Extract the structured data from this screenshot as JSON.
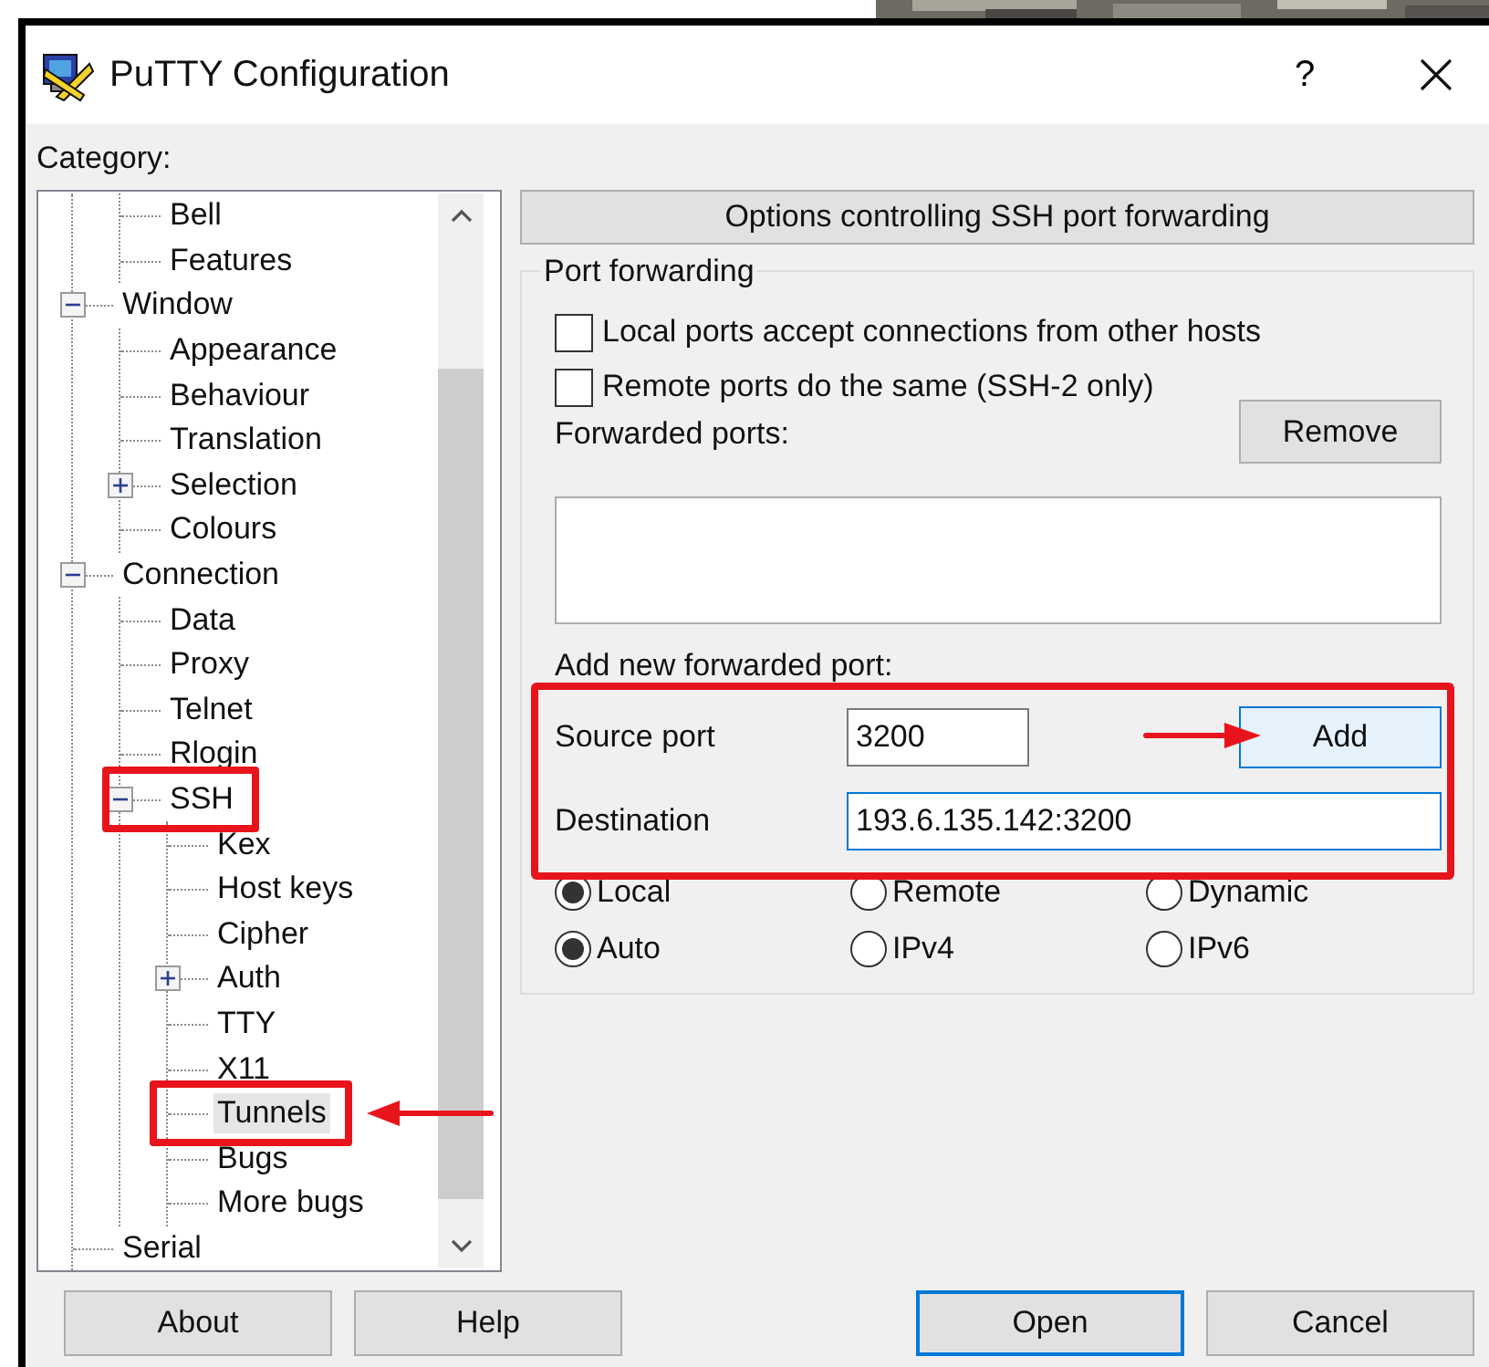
{
  "window": {
    "title": "PuTTY Configuration",
    "help_button": "?"
  },
  "category_label": "Category:",
  "tree": {
    "scrolled_parent_children": [
      {
        "label": "Bell",
        "selected": false
      },
      {
        "label": "Features",
        "selected": false
      }
    ],
    "items": [
      {
        "label": "Window",
        "selected": false,
        "expanded": true,
        "children": [
          {
            "label": "Appearance",
            "selected": false
          },
          {
            "label": "Behaviour",
            "selected": false
          },
          {
            "label": "Translation",
            "selected": false
          },
          {
            "label": "Selection",
            "selected": false,
            "expanded": false
          },
          {
            "label": "Colours",
            "selected": false
          }
        ]
      },
      {
        "label": "Connection",
        "selected": false,
        "expanded": true,
        "children": [
          {
            "label": "Data",
            "selected": false
          },
          {
            "label": "Proxy",
            "selected": false
          },
          {
            "label": "Telnet",
            "selected": false
          },
          {
            "label": "Rlogin",
            "selected": false
          },
          {
            "label": "SSH",
            "selected": false,
            "highlight": true,
            "expanded": true,
            "children": [
              {
                "label": "Kex",
                "selected": false
              },
              {
                "label": "Host keys",
                "selected": false
              },
              {
                "label": "Cipher",
                "selected": false
              },
              {
                "label": "Auth",
                "selected": false,
                "expanded": false
              },
              {
                "label": "TTY",
                "selected": false
              },
              {
                "label": "X11",
                "selected": false
              },
              {
                "label": "Tunnels",
                "selected": true,
                "highlight": true,
                "arrow": true
              },
              {
                "label": "Bugs",
                "selected": false
              },
              {
                "label": "More bugs",
                "selected": false
              }
            ]
          }
        ]
      },
      {
        "label": "Serial",
        "selected": false
      }
    ]
  },
  "panel": {
    "header": "Options controlling SSH port forwarding",
    "group_title": "Port forwarding",
    "checkboxes": [
      {
        "label": "Local ports accept connections from other hosts",
        "checked": false
      },
      {
        "label": "Remote ports do the same (SSH-2 only)",
        "checked": false
      }
    ],
    "forwarded_label": "Forwarded ports:",
    "remove_button": "Remove",
    "add_label": "Add new forwarded port:",
    "add_section": {
      "highlight": true,
      "source_label": "Source port",
      "source_value": "3200",
      "add_button": "Add",
      "add_arrow": true,
      "destination_label": "Destination",
      "destination_value": "193.6.135.142:3200",
      "destination_focused": true
    },
    "direction": [
      {
        "label": "Local",
        "selected": true
      },
      {
        "label": "Remote",
        "selected": false
      },
      {
        "label": "Dynamic",
        "selected": false
      }
    ],
    "ip_version": [
      {
        "label": "Auto",
        "selected": true
      },
      {
        "label": "IPv4",
        "selected": false
      },
      {
        "label": "IPv6",
        "selected": false
      }
    ]
  },
  "buttons": [
    {
      "label": "About",
      "default": false
    },
    {
      "label": "Help",
      "default": false
    },
    {
      "label": "Open",
      "default": true
    },
    {
      "label": "Cancel",
      "default": false
    }
  ]
}
